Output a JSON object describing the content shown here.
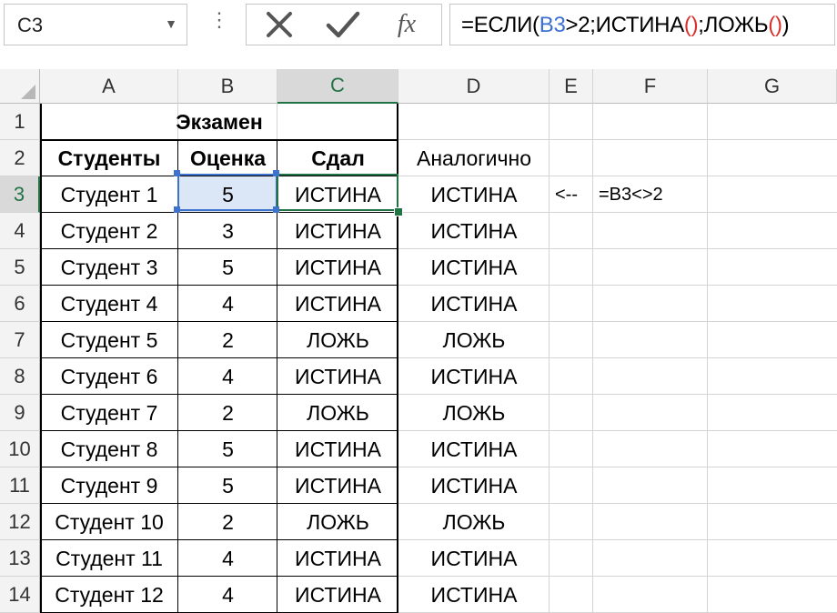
{
  "namebox": {
    "value": "C3"
  },
  "formula_bar": {
    "parts": [
      "=ЕСЛИ(",
      "B3",
      ">2;ИСТИНА",
      "()",
      ";ЛОЖЬ",
      "()",
      ")"
    ]
  },
  "columns": [
    "A",
    "B",
    "C",
    "D",
    "E",
    "F",
    "G"
  ],
  "rows": [
    "1",
    "2",
    "3",
    "4",
    "5",
    "6",
    "7",
    "8",
    "9",
    "10",
    "11",
    "12",
    "13",
    "14"
  ],
  "table": {
    "title": "Экзамен",
    "headers": {
      "students": "Студенты",
      "grade": "Оценка",
      "passed": "Сдал",
      "similar": "Аналогично"
    },
    "records": [
      {
        "student": "Студент 1",
        "grade": "5",
        "passed": "ИСТИНА",
        "similar": "ИСТИНА"
      },
      {
        "student": "Студент 2",
        "grade": "3",
        "passed": "ИСТИНА",
        "similar": "ИСТИНА"
      },
      {
        "student": "Студент 3",
        "grade": "5",
        "passed": "ИСТИНА",
        "similar": "ИСТИНА"
      },
      {
        "student": "Студент 4",
        "grade": "4",
        "passed": "ИСТИНА",
        "similar": "ИСТИНА"
      },
      {
        "student": "Студент 5",
        "grade": "2",
        "passed": "ЛОЖЬ",
        "similar": "ЛОЖЬ"
      },
      {
        "student": "Студент 6",
        "grade": "4",
        "passed": "ИСТИНА",
        "similar": "ИСТИНА"
      },
      {
        "student": "Студент 7",
        "grade": "2",
        "passed": "ЛОЖЬ",
        "similar": "ЛОЖЬ"
      },
      {
        "student": "Студент 8",
        "grade": "5",
        "passed": "ИСТИНА",
        "similar": "ИСТИНА"
      },
      {
        "student": "Студент 9",
        "grade": "5",
        "passed": "ИСТИНА",
        "similar": "ИСТИНА"
      },
      {
        "student": "Студент 10",
        "grade": "2",
        "passed": "ЛОЖЬ",
        "similar": "ЛОЖЬ"
      },
      {
        "student": "Студент 11",
        "grade": "4",
        "passed": "ИСТИНА",
        "similar": "ИСТИНА"
      },
      {
        "student": "Студент 12",
        "grade": "4",
        "passed": "ИСТИНА",
        "similar": "ИСТИНА"
      }
    ]
  },
  "annotations": {
    "arrow": "<--",
    "formula_note": "=B3<>2"
  },
  "icons": {
    "cancel": "x-icon",
    "enter": "checkmark-icon",
    "function": "fx-icon",
    "dropdown": "chevron-down-icon",
    "more": "vertical-dots-icon"
  },
  "colors": {
    "accent_green": "#217346",
    "selection_blue": "#3d73cc",
    "ref_blue": "#3b6fd0",
    "paren_red": "#d9302c"
  }
}
